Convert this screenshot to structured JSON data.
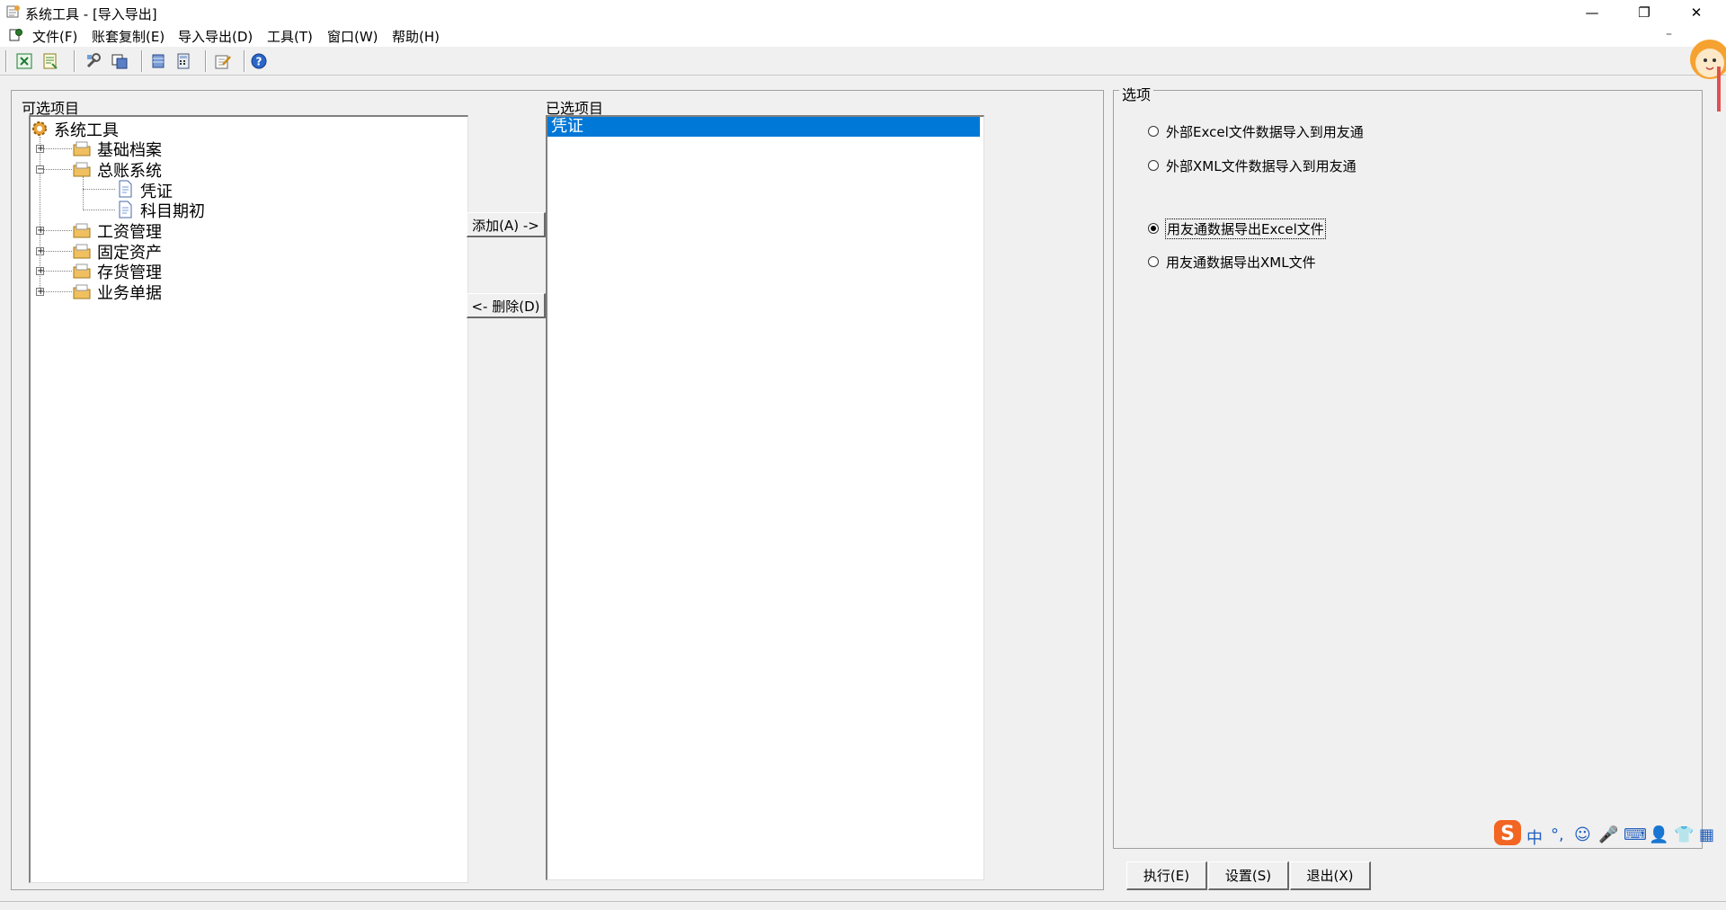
{
  "window": {
    "title": "系统工具 - [导入导出]",
    "controls": {
      "minimize": "—",
      "maximize": "❐",
      "close": "✕"
    }
  },
  "menu": {
    "items": [
      "文件(F)",
      "账套复制(E)",
      "导入导出(D)",
      "工具(T)",
      "窗口(W)",
      "帮助(H)"
    ],
    "mdi_minimize": "–"
  },
  "toolbar": {
    "icons": [
      "excel-export-icon",
      "excel-import-icon",
      "tools-icon",
      "copy-icon",
      "database-icon",
      "calculator-icon",
      "edit-icon",
      "help-icon"
    ]
  },
  "available": {
    "label": "可选项目",
    "root": "系统工具",
    "nodes": [
      {
        "label": "基础档案",
        "expander": "+"
      },
      {
        "label": "总账系统",
        "expander": "−",
        "children": [
          "凭证",
          "科目期初"
        ]
      },
      {
        "label": "工资管理",
        "expander": "+"
      },
      {
        "label": "固定资产",
        "expander": "+"
      },
      {
        "label": "存货管理",
        "expander": "+"
      },
      {
        "label": "业务单据",
        "expander": "+"
      }
    ]
  },
  "buttons": {
    "add": "添加(A) ->",
    "remove": "<- 删除(D)",
    "execute": "执行(E)",
    "settings": "设置(S)",
    "exit": "退出(X)"
  },
  "selected": {
    "label": "已选项目",
    "items": [
      "凭证"
    ]
  },
  "options": {
    "legend": "选项",
    "radios": [
      {
        "label": "外部Excel文件数据导入到用友通",
        "checked": false
      },
      {
        "label": "外部XML文件数据导入到用友通",
        "checked": false
      },
      {
        "label": "用友通数据导出Excel文件",
        "checked": true
      },
      {
        "label": "用友通数据导出XML文件",
        "checked": false
      }
    ]
  },
  "ime": {
    "items": [
      "中",
      "°,",
      "☺",
      "🎤",
      "⌨",
      "👤",
      "👕",
      "▦"
    ]
  },
  "colors": {
    "selection": "#0078d7",
    "window_bg": "#f0f0f0",
    "ime_accent": "#1f5fbf",
    "ime_logo": "#f26522"
  }
}
